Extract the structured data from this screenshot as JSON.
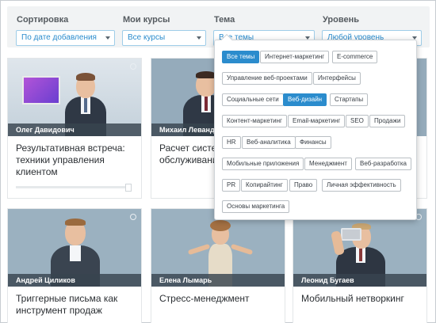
{
  "filters": {
    "sort": {
      "label": "Сортировка",
      "value": "По дате добавления"
    },
    "my_courses": {
      "label": "Мои курсы",
      "value": "Все курсы"
    },
    "topic": {
      "label": "Тема",
      "value": "Все темы"
    },
    "level": {
      "label": "Уровень",
      "value": "Любой уровень"
    }
  },
  "cards": [
    {
      "author": "Олег Давидович",
      "title": "Результативная встреча: техники управления клиентом"
    },
    {
      "author": "Михаил Левандо",
      "title": "Расчет систем обслуживани"
    },
    {
      "author": "",
      "title": ""
    },
    {
      "author": "Андрей Циликов",
      "title": "Триггерные письма как инструмент продаж"
    },
    {
      "author": "Елена Лымарь",
      "title": "Стресс-менеджмент"
    },
    {
      "author": "Леонид Бугаев",
      "title": "Мобильный нетворкинг"
    }
  ],
  "topic_options": [
    "Все темы",
    "Интернет-маркетинг",
    "E-commerce",
    "Управление веб-проектами",
    "Интерфейсы",
    "Социальные сети",
    "Веб-дизайн",
    "Стартапы",
    "Контент-маркетинг",
    "Email-маркетинг",
    "SEO",
    "Продажи",
    "HR",
    "Веб-аналитика",
    "Финансы",
    "Мобильные приложения",
    "Менеджмент",
    "Веб-разработка",
    "PR",
    "Копирайтинг",
    "Право",
    "Личная эффективность",
    "Основы маркетинга"
  ],
  "colors": {
    "accent": "#2b8ccd",
    "selected_tag": "#2b8ccd",
    "name_band": "#38444f"
  }
}
